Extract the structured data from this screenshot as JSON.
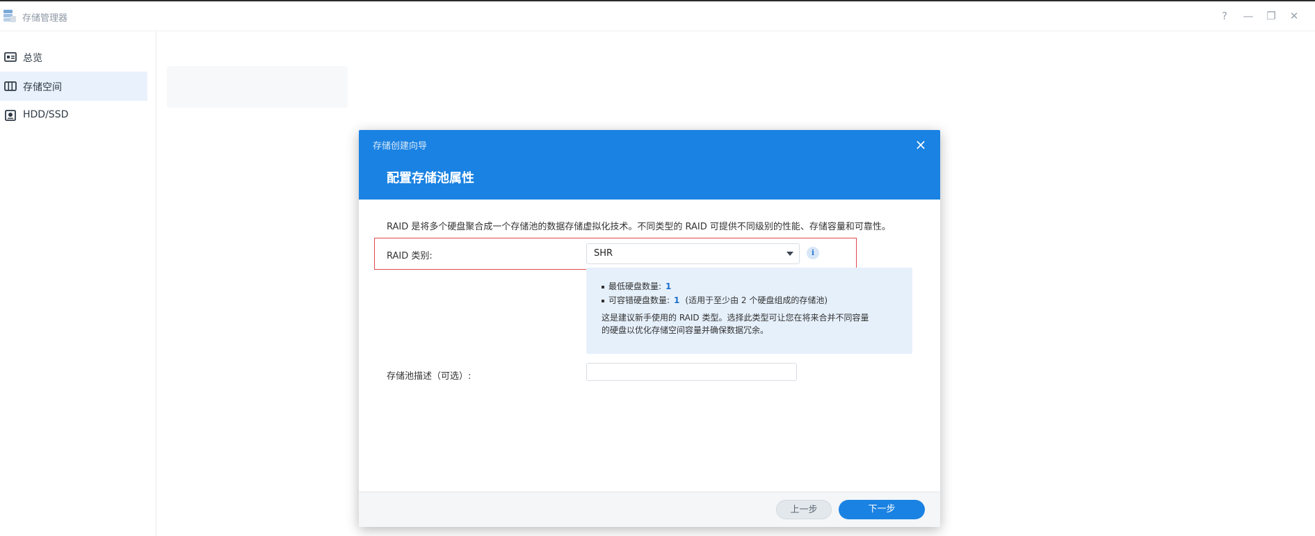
{
  "app": {
    "title": "存储管理器",
    "icon": "storage-manager-icon",
    "window_controls": [
      "?",
      "—",
      "❐",
      "✕"
    ]
  },
  "sidebar": {
    "items": [
      {
        "label": "总览",
        "icon": "overview-icon",
        "active": false
      },
      {
        "label": "存储空间",
        "icon": "storage-space-icon",
        "active": true
      },
      {
        "label": "HDD/SSD",
        "icon": "disk-icon",
        "active": false
      }
    ]
  },
  "dialog": {
    "wizard_title": "存储创建向导",
    "page_title": "配置存储池属性",
    "close_icon": "×",
    "description": "RAID 是将多个硬盘聚合成一个存储池的数据存储虚拟化技术。不同类型的 RAID 可提供不同级别的性能、存储容量和可靠性。",
    "raid_label": "RAID 类别:",
    "raid_value": "SHR",
    "info_icon": "i",
    "info": {
      "min_disks_label": "最低硬盘数量:",
      "min_disks_value": "1",
      "fault_tolerance_label": "可容错硬盘数量:",
      "fault_tolerance_value": "1",
      "fault_tolerance_note": "(适用于至少由 2 个硬盘组成的存储池)",
      "note_line1": "这是建议新手使用的 RAID 类型。选择此类型可让您在将来合并不同容量",
      "note_line2": "的硬盘以优化存储空间容量并确保数据冗余。"
    },
    "pool_desc_label": "存储池描述（可选）:",
    "pool_desc_value": "",
    "prev_button": "上一步",
    "next_button": "下一步"
  },
  "colors": {
    "accent": "#1a82e2",
    "highlight_border": "#e0474c",
    "info_bg": "#e6f0fb",
    "sidebar_active_bg": "#e9f2fc"
  }
}
